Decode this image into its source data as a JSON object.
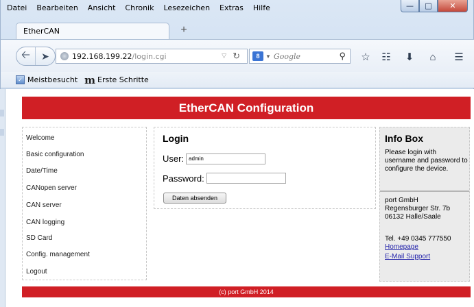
{
  "browser": {
    "menu": [
      "Datei",
      "Bearbeiten",
      "Ansicht",
      "Chronik",
      "Lesezeichen",
      "Extras",
      "Hilfe"
    ],
    "tab_title": "EtherCAN",
    "url_host": "192.168.199.22",
    "url_path": "/login.cgi",
    "search_placeholder": "Google",
    "bookmarks": [
      "Meistbesucht",
      "Erste Schritte"
    ]
  },
  "page": {
    "header": "EtherCAN Configuration",
    "nav": [
      "Welcome",
      "Basic configuration",
      "Date/Time",
      "CANopen server",
      "CAN server",
      "CAN logging",
      "SD Card",
      "Config. management",
      "Logout"
    ],
    "login": {
      "title": "Login",
      "user_label": "User:",
      "user_value": "admin",
      "password_label": "Password:",
      "password_value": "",
      "submit": "Daten absenden"
    },
    "info": {
      "title": "Info Box",
      "text": "Please login with username and password to configure the device.",
      "address": [
        "port GmbH",
        "Regensburger Str. 7b",
        "06132 Halle/Saale"
      ],
      "phone": "Tel. +49 0345 777550",
      "links": [
        "Homepage",
        "E-Mail Support"
      ]
    },
    "footer": "(c) port GmbH 2014"
  }
}
